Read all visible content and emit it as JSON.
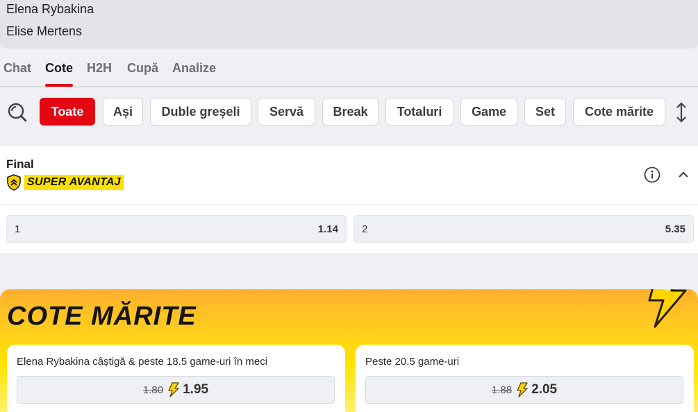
{
  "players": {
    "home": "Elena Rybakina",
    "away": "Elise Mertens"
  },
  "tabs": [
    {
      "label": "Chat"
    },
    {
      "label": "Cote"
    },
    {
      "label": "H2H"
    },
    {
      "label": "Cupă"
    },
    {
      "label": "Analize"
    }
  ],
  "active_tab": "Cote",
  "filters": [
    {
      "label": "Toate"
    },
    {
      "label": "Ași"
    },
    {
      "label": "Duble greșeli"
    },
    {
      "label": "Servă"
    },
    {
      "label": "Break"
    },
    {
      "label": "Totaluri"
    },
    {
      "label": "Game"
    },
    {
      "label": "Set"
    },
    {
      "label": "Cote mărite"
    }
  ],
  "active_filter": "Toate",
  "market": {
    "title": "Final",
    "badge": "SUPER AVANTAJ",
    "outcomes": [
      {
        "label": "1",
        "odd": "1.14"
      },
      {
        "label": "2",
        "odd": "5.35"
      }
    ]
  },
  "boosted": {
    "title": "COTE MĂRITE",
    "cards": [
      {
        "label": "Elena Rybakina câștigă & peste 18.5 game-uri în meci",
        "old_odd": "1.80",
        "new_odd": "1.95"
      },
      {
        "label": "Peste 20.5 game-uri",
        "old_odd": "1.88",
        "new_odd": "2.05"
      }
    ]
  },
  "colors": {
    "brand_red": "#e30613",
    "boost_yellow": "#ffe100",
    "boost_orange": "#ffb02e"
  },
  "icons": [
    "search-icon",
    "sort-icon",
    "shield-icon",
    "info-icon",
    "chevron-up-icon",
    "lightning-icon"
  ]
}
